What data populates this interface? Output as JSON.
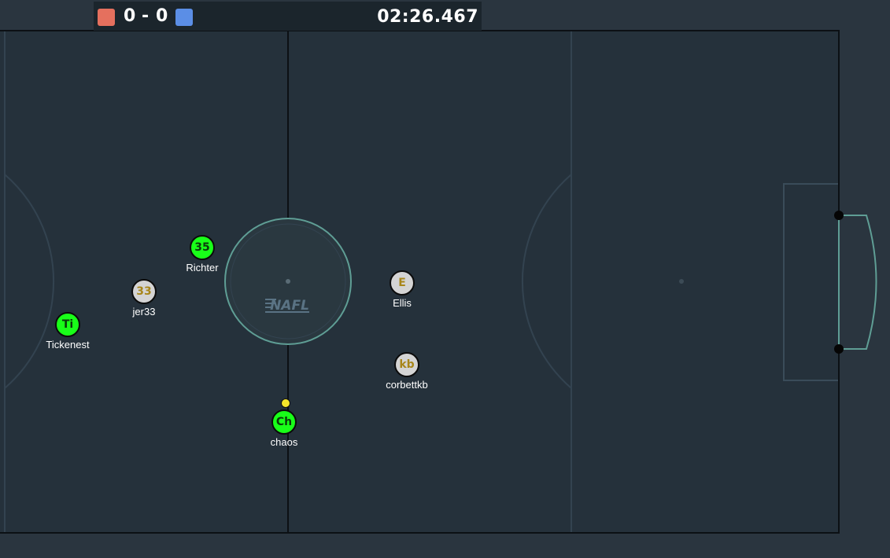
{
  "scoreboard": {
    "red_color": "#e5705e",
    "blue_color": "#5b8ee6",
    "red_score": "0",
    "separator": "-",
    "blue_score": "0",
    "clock": "02:26.467"
  },
  "field": {
    "logo_text": "NAFL"
  },
  "players": [
    {
      "initials": "35",
      "name": "Richter",
      "team": "green"
    },
    {
      "initials": "33",
      "name": "jer33",
      "team": "grey"
    },
    {
      "initials": "Ti",
      "name": "Tickenest",
      "team": "green"
    },
    {
      "initials": "Ch",
      "name": "chaos",
      "team": "green"
    },
    {
      "initials": "E",
      "name": "Ellis",
      "team": "grey"
    },
    {
      "initials": "kb",
      "name": "corbettkb",
      "team": "grey"
    }
  ],
  "colors": {
    "pitch": "#25313b",
    "pitch_line": "#3a4a55",
    "goal_line": "#5f9e95",
    "green_player": "#19ff19",
    "grey_player": "#d4d4d4",
    "ball": "#f5e52a"
  }
}
